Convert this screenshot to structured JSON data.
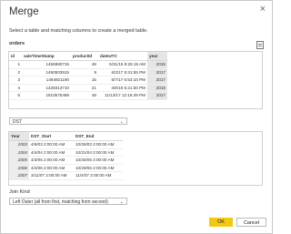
{
  "dialog": {
    "title": "Merge",
    "close_glyph": "×",
    "subtitle": "Select a table and matching columns to create a merged table."
  },
  "top_table": {
    "name": "orders",
    "columns": [
      "id",
      "saleTimeStamp",
      "productId",
      "dateUTC",
      "year"
    ],
    "rows": [
      [
        "1",
        "1455980715",
        "48",
        "5/31/15 8:25:15 AM",
        "2015"
      ],
      [
        "2",
        "1490503915",
        "9",
        "6/3/17 5:31:55 PM",
        "2017"
      ],
      [
        "3",
        "1494921190",
        "15",
        "5/7/17 6:53:10 PM",
        "2017"
      ],
      [
        "4",
        "1428313710",
        "21",
        "4/8/15 5:21:50 PM",
        "2015"
      ],
      [
        "5",
        "1510575469",
        "48",
        "11/13/17 12:16:49 PM",
        "2017"
      ]
    ]
  },
  "bottom_dropdown": {
    "value": "DST"
  },
  "bottom_table": {
    "columns": [
      "Year",
      "DST_Start",
      "DST_End"
    ],
    "rows": [
      [
        "2003",
        "4/6/03 2:00:00 AM",
        "10/26/03 2:00:00 AM"
      ],
      [
        "2004",
        "4/4/04 2:00:00 AM",
        "10/31/04 2:00:00 AM"
      ],
      [
        "2005",
        "4/3/05 2:00:00 AM",
        "10/30/05 2:00:00 AM"
      ],
      [
        "2006",
        "4/2/06 2:00:00 AM",
        "10/29/06 2:00:00 AM"
      ],
      [
        "2007",
        "3/11/07 2:00:00 AM",
        "11/4/07 2:00:00 AM"
      ]
    ]
  },
  "join": {
    "label": "Join Kind",
    "value": "Left Outer (all from first, matching from second)"
  },
  "buttons": {
    "ok": "OK",
    "cancel": "Cancel"
  },
  "colors": {
    "accent": "#f2c811",
    "selected_column": "#e6e6e6"
  },
  "icons": {
    "close": "close-icon",
    "dropdown": "chevron-down-icon",
    "preview": "document-icon"
  }
}
